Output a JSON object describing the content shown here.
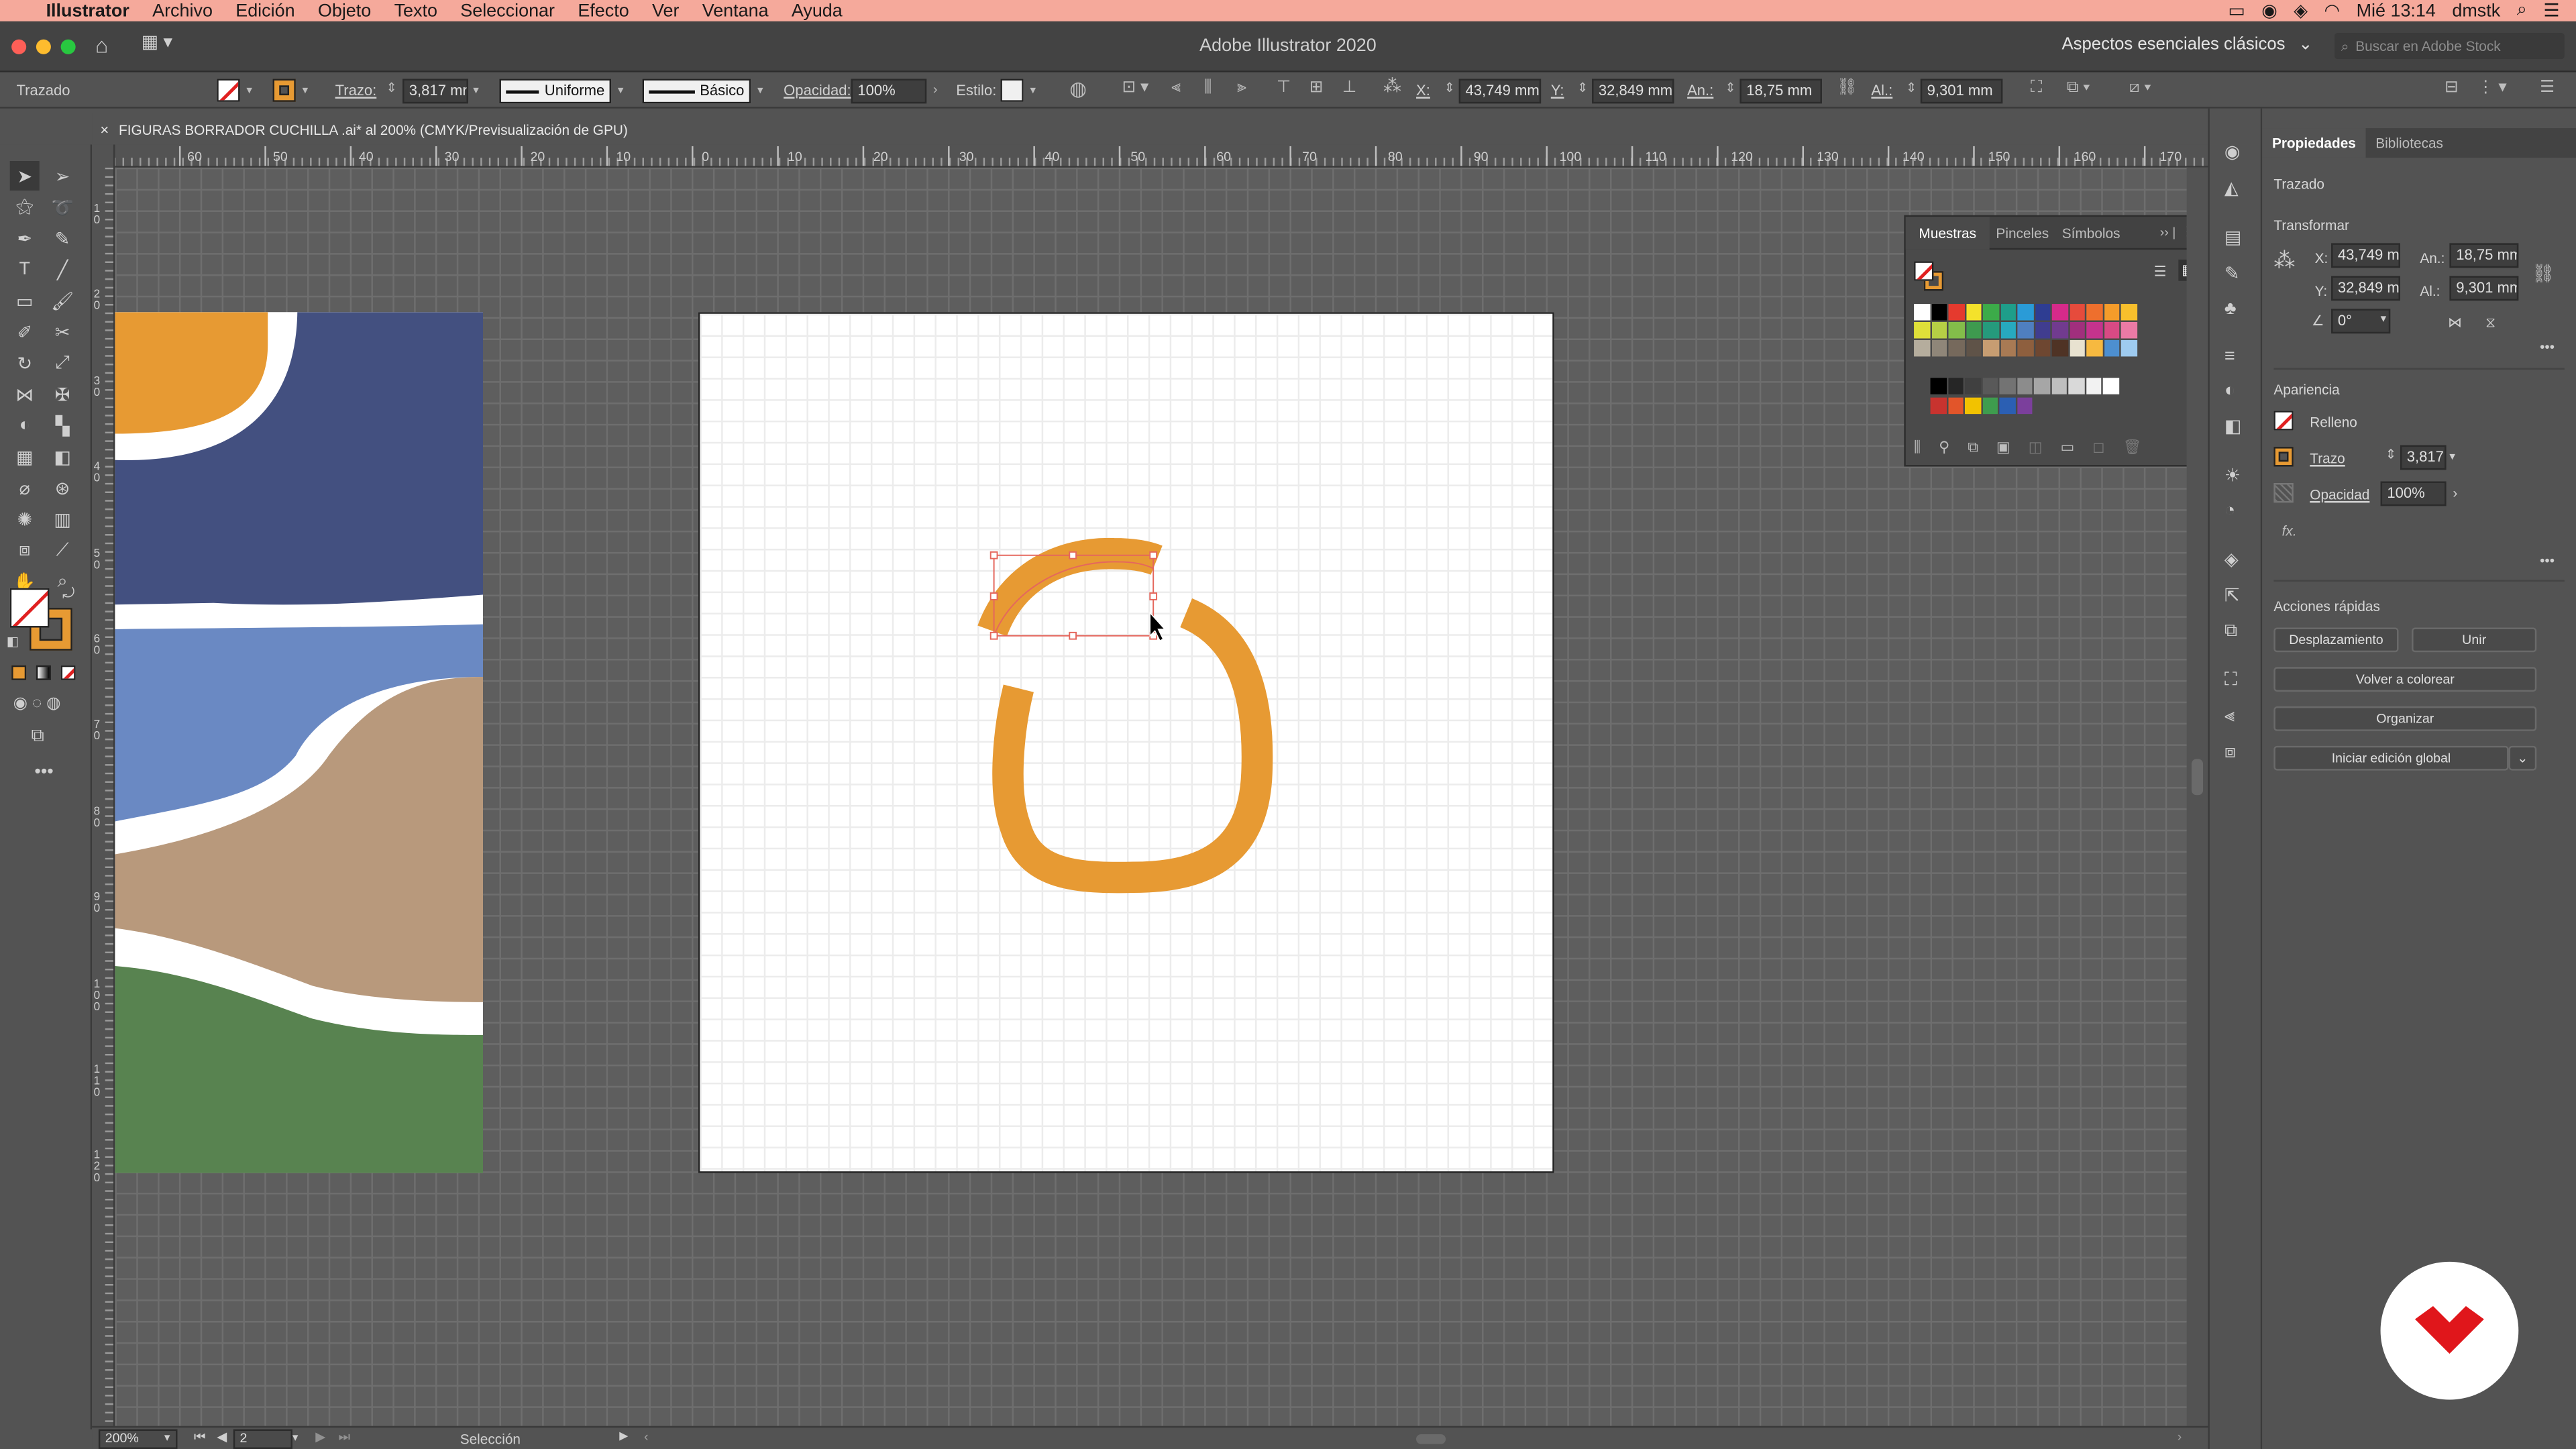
{
  "menubar": {
    "app": "Illustrator",
    "items": [
      "Archivo",
      "Edición",
      "Objeto",
      "Texto",
      "Seleccionar",
      "Efecto",
      "Ver",
      "Ventana",
      "Ayuda"
    ],
    "clock": "Mié 13:14",
    "user": "dmstk"
  },
  "titlebar": {
    "title": "Adobe Illustrator 2020",
    "workspace": "Aspectos esenciales clásicos",
    "stock_placeholder": "Buscar en Adobe Stock"
  },
  "control": {
    "object_type": "Trazado",
    "stroke_label": "Trazo:",
    "stroke_value": "3,817 mr",
    "profile": "Uniforme",
    "brush": "Básico",
    "opacity_label": "Opacidad:",
    "opacity_value": "100%",
    "style_label": "Estilo:",
    "x_label": "X:",
    "x_value": "43,749 mm",
    "y_label": "Y:",
    "y_value": "32,849 mm",
    "w_label": "An.:",
    "w_value": "18,75 mm",
    "h_label": "Al.:",
    "h_value": "9,301 mm"
  },
  "document": {
    "tab": "FIGURAS BORRADOR CUCHILLA .ai* al 200% (CMYK/Previsualización de GPU)"
  },
  "ruler": {
    "h": [
      "60",
      "50",
      "40",
      "30",
      "20",
      "10",
      "0",
      "10",
      "20",
      "30",
      "40",
      "50",
      "60",
      "70",
      "80",
      "90",
      "100",
      "110",
      "120",
      "130",
      "140",
      "150",
      "160",
      "170"
    ],
    "v": [
      "1 0",
      "2 0",
      "3 0",
      "4 0",
      "5 0",
      "6 0",
      "7 0",
      "8 0",
      "9 0",
      "1 0 0",
      "1 1 0",
      "1 2 0"
    ]
  },
  "swatches_panel": {
    "tabs": [
      "Muestras",
      "Pinceles",
      "Símbolos"
    ],
    "colors_row1": [
      "#ffffff",
      "#000000",
      "#e53a2e",
      "#f4e22b",
      "#3cab49",
      "#1e9e8a",
      "#2a9bd7",
      "#2e3d92",
      "#d62a8a",
      "#e64b3c",
      "#ee6f2d",
      "#f59c2a",
      "#f7bf2c"
    ],
    "colors_row2": [
      "#dfe039",
      "#b6cf45",
      "#83bd4a",
      "#3e9a4f",
      "#259a7c",
      "#27a9bf",
      "#4f7fc0",
      "#403d8f",
      "#713b8f",
      "#a12f7d",
      "#c5338d",
      "#d84a84",
      "#eb7aa5"
    ],
    "colors_row3": [
      "#b5ad9d",
      "#8f8679",
      "#76695c",
      "#5f5348",
      "#c79d72",
      "#a87a54",
      "#8e5f3e",
      "#6e4731",
      "#4f3325",
      "#e8e2d0",
      "#f6b940",
      "#4d8fd0",
      "#9ecbf0"
    ],
    "grays": [
      "#000000",
      "#262626",
      "#404040",
      "#595959",
      "#737373",
      "#8c8c8c",
      "#a6a6a6",
      "#bfbfbf",
      "#d9d9d9",
      "#f2f2f2",
      "#ffffff"
    ],
    "group": [
      "#c8332f",
      "#e2552a",
      "#f2c200",
      "#3e9c4e",
      "#2b5fb3",
      "#7b3f9c"
    ]
  },
  "properties": {
    "tabs": [
      "Propiedades",
      "Bibliotecas"
    ],
    "object": "Trazado",
    "transform_title": "Transformar",
    "x_label": "X:",
    "x_value": "43,749 m",
    "y_label": "Y:",
    "y_value": "32,849 m",
    "w_label": "An.:",
    "w_value": "18,75 mm",
    "h_label": "Al.:",
    "h_value": "9,301 mm",
    "angle": "0°",
    "appearance_title": "Apariencia",
    "fill_label": "Relleno",
    "stroke_label": "Trazo",
    "stroke_value": "3,817",
    "opacity_label": "Opacidad",
    "opacity_value": "100%",
    "fx": "fx.",
    "quick_title": "Acciones rápidas",
    "btn_offset": "Desplazamiento",
    "btn_join": "Unir",
    "btn_recolor": "Volver a colorear",
    "btn_arrange": "Organizar",
    "btn_global": "Iniciar edición global"
  },
  "status": {
    "zoom": "200%",
    "artboard": "2",
    "tool": "Selección"
  },
  "colors": {
    "orange": "#e79a33",
    "navy": "#435080",
    "blue": "#6a89c3",
    "tan": "#b8997c",
    "green": "#588350",
    "menubar": "#f5a99b",
    "brand_red": "#e0161b"
  }
}
